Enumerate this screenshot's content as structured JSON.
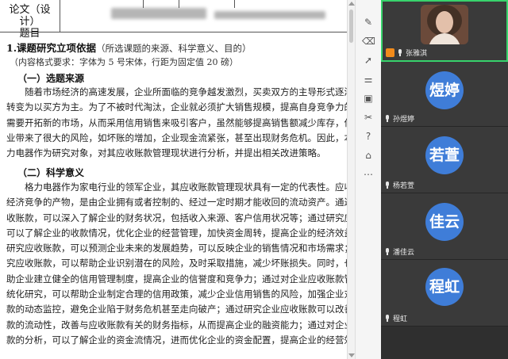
{
  "document": {
    "header_label": "论文（设计）\n题目",
    "section_title": "1.课题研究立项依据",
    "section_note": "（所选课题的来源、科学意义、目的）",
    "format_note": "（内容格式要求：字体为 5 号宋体，行距为固定值 20 磅）",
    "sub1": "（一）选题来源",
    "para1": [
      "　　随着市场经济的高速发展，企业所面临的竞争越发激烈，买卖双方的主导形式逐渐从卖",
      "转变为以买方为主。为了不被时代淘汰，企业就必须扩大销售规模，提高自身竞争力的同时",
      "需要开拓新的市场，从而采用信用销售来吸引客户，虽然能够提高销售额减少库存，但也给",
      "业带来了很大的风险，如坏账的增加，企业现金流紧张，甚至出现财务危机。因此，本文以格",
      "力电器作为研究对象，对其应收账款管理现状进行分析，并提出相关改进策略。"
    ],
    "sub2": "（二）科学意义",
    "para2": [
      "　　格力电器作为家电行业的领军企业，其应收账款管理现状具有一定的代表性。应收账款",
      "经济竞争的产物，是由企业拥有或者控制的、经过一定时期才能收回的流动资产。通过研究应",
      "收账款，可以深入了解企业的财务状况，包括收入来源、客户信用状况等；通过研究应收账款",
      "可以了解企业的收款情况，优化企业的经营管理，加快资金周转，提高企业的经济效益；通",
      "研究应收账款，可以预测企业未来的发展趋势，可以反映企业的销售情况和市场需求；通过研",
      "究应收账款，可以帮助企业识别潜在的风险，及时采取措施，减少坏账损失。同时，也可以",
      "助企业建立健全的信用管理制度，提高企业的信誉度和竞争力；通过对企业应收账款管理的",
      "统化研究，可以帮助企业制定合理的信用政策，减少企业信用销售的风险，加强企业对应收账",
      "款的动态监控，避免企业陷于财务危机甚至走向破产；通过研究企业应收账款可以改善应收账",
      "款的流动性，改善与应收账款有关的财务指标，从而提高企业的融资能力；通过对企业应收账",
      "款的分析，可以了解企业的资金流情况，进而优化企业的资金配置，提高企业的经营效率。"
    ]
  },
  "toolbar": {
    "tools": [
      "pencil-icon",
      "eraser-icon",
      "pointer-icon",
      "text-format-icon",
      "shape-icon",
      "settings-icon",
      "help-icon",
      "stamp-icon",
      "more-icon"
    ]
  },
  "participants": [
    {
      "name": "张雅淇",
      "avatar_text": "",
      "photo": true,
      "active": true,
      "host": true
    },
    {
      "name": "孙煜婷",
      "avatar_text": "煜婷",
      "photo": false
    },
    {
      "name": "杨若萱",
      "avatar_text": "若萱",
      "photo": false
    },
    {
      "name": "潘佳云",
      "avatar_text": "佳云",
      "photo": false
    },
    {
      "name": "程虹",
      "avatar_text": "程虹",
      "photo": false
    }
  ],
  "colors": {
    "avatar_blue": "#3f7dd8",
    "active_border": "#38d36c",
    "host_orange": "#f28b1b"
  }
}
